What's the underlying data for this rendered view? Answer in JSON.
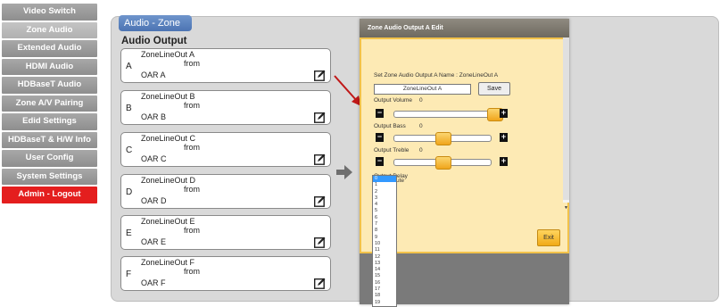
{
  "sidebar": {
    "items": [
      {
        "label": "Video Switch"
      },
      {
        "label": "Zone Audio"
      },
      {
        "label": "Extended Audio"
      },
      {
        "label": "HDMI Audio"
      },
      {
        "label": "HDBaseT Audio"
      },
      {
        "label": "Zone A/V Pairing"
      },
      {
        "label": "Edid Settings"
      },
      {
        "label": "HDBaseT & H/W Info"
      },
      {
        "label": "User Config"
      },
      {
        "label": "System Settings"
      },
      {
        "label": "Admin - Logout"
      }
    ]
  },
  "main": {
    "tab": "Audio - Zone",
    "section_title": "Audio Output",
    "zones": [
      {
        "letter": "A",
        "name": "ZoneLineOut A",
        "from": "from",
        "source": "OAR A"
      },
      {
        "letter": "B",
        "name": "ZoneLineOut B",
        "from": "from",
        "source": "OAR B"
      },
      {
        "letter": "C",
        "name": "ZoneLineOut C",
        "from": "from",
        "source": "OAR C"
      },
      {
        "letter": "D",
        "name": "ZoneLineOut D",
        "from": "from",
        "source": "OAR D"
      },
      {
        "letter": "E",
        "name": "ZoneLineOut E",
        "from": "from",
        "source": "OAR E"
      },
      {
        "letter": "F",
        "name": "ZoneLineOut F",
        "from": "from",
        "source": "OAR F"
      }
    ]
  },
  "dialog": {
    "title": "Zone Audio Output A Edit",
    "set_name_label": "Set Zone Audio Output A Name : ZoneLineOut A",
    "name_value": "ZoneLineOut A",
    "save_label": "Save",
    "volume_label": "Output Volume",
    "volume_value": "0",
    "volume_level": 1.0,
    "bass_label": "Output Bass",
    "bass_value": "0",
    "bass_level": 0.5,
    "treble_label": "Output Treble",
    "treble_value": "0",
    "treble_level": 0.5,
    "delay_label": "Output Delay",
    "delay_value": "0",
    "mute_label": "ute",
    "exit_label": "Exit",
    "minus_glyph": "−",
    "plus_glyph": "+",
    "delay_options": [
      "0",
      "1",
      "2",
      "3",
      "4",
      "5",
      "6",
      "7",
      "8",
      "9",
      "10",
      "11",
      "12",
      "13",
      "14",
      "15",
      "16",
      "17",
      "18",
      "19"
    ]
  }
}
